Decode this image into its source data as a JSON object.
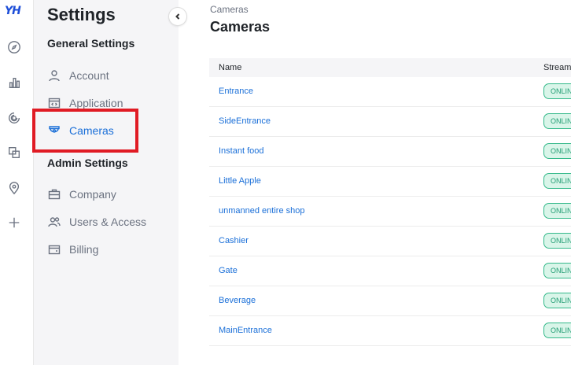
{
  "rail": {
    "logo_text": "YH",
    "icons": [
      "compass-icon",
      "bar-chart-icon",
      "radar-icon",
      "copy-icon",
      "location-pin-icon",
      "plus-icon"
    ]
  },
  "settings": {
    "title": "Settings",
    "general_title": "General Settings",
    "general_items": [
      {
        "label": "Account",
        "icon": "user-icon"
      },
      {
        "label": "Application",
        "icon": "code-window-icon"
      },
      {
        "label": "Cameras",
        "icon": "camera-icon",
        "active": true
      }
    ],
    "admin_title": "Admin Settings",
    "admin_items": [
      {
        "label": "Company",
        "icon": "briefcase-icon"
      },
      {
        "label": "Users & Access",
        "icon": "users-icon"
      },
      {
        "label": "Billing",
        "icon": "wallet-icon"
      }
    ]
  },
  "main": {
    "breadcrumb": "Cameras",
    "title": "Cameras",
    "columns": {
      "name": "Name",
      "stream": "Stream"
    },
    "cameras": [
      {
        "name": "Entrance",
        "status": "ONLINE"
      },
      {
        "name": "SideEntrance",
        "status": "ONLINE"
      },
      {
        "name": "Instant food",
        "status": "ONLINE"
      },
      {
        "name": "Little Apple",
        "status": "ONLINE"
      },
      {
        "name": "unmanned entire shop",
        "status": "ONLINE"
      },
      {
        "name": "Cashier",
        "status": "ONLINE"
      },
      {
        "name": "Gate",
        "status": "ONLINE"
      },
      {
        "name": "Beverage",
        "status": "ONLINE"
      },
      {
        "name": "MainEntrance",
        "status": "ONLINE"
      }
    ]
  },
  "colors": {
    "accent": "#1a6fd8",
    "highlight": "#e01b24",
    "online_bg": "#d9f5e9",
    "online_text": "#1f9c72"
  }
}
